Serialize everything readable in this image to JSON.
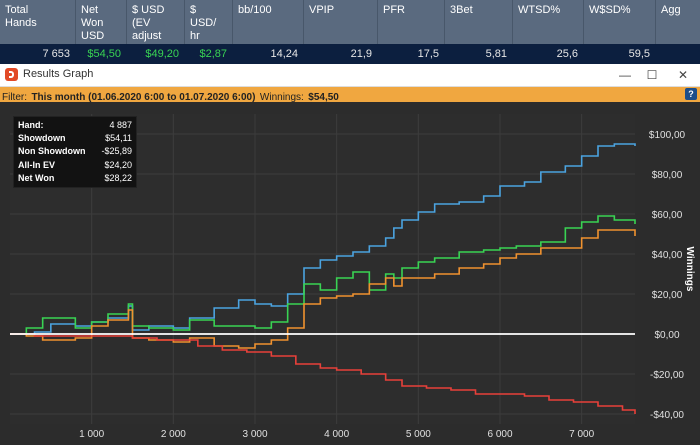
{
  "stats": {
    "headers": [
      "Total\nHands",
      "Net\nWon\nUSD",
      "$ USD\n(EV\nadjust",
      "$\nUSD/\nhr",
      "bb/100",
      "VPIP",
      "PFR",
      "3Bet",
      "WTSD%",
      "W$SD%",
      "Agg"
    ],
    "values": [
      "7 653",
      "$54,50",
      "$49,20",
      "$2,87",
      "14,24",
      "21,9",
      "17,5",
      "5,81",
      "25,6",
      "59,5",
      ""
    ]
  },
  "window": {
    "title": "Results Graph",
    "minimize": "—",
    "maximize": "☐",
    "close": "✕"
  },
  "filter": {
    "label": "Filter:",
    "range": "This month (01.06.2020 6:00 to 01.07.2020 6:00)",
    "winnings_label": "Winnings:",
    "winnings_value": "$54,50",
    "help": "?"
  },
  "legend": {
    "rows": [
      {
        "label": "Hand:",
        "value": "4 887"
      },
      {
        "label": "Showdown",
        "value": "$54,11"
      },
      {
        "label": "Non Showdown",
        "value": "-$25,89"
      },
      {
        "label": "All-In EV",
        "value": "$24,20"
      },
      {
        "label": "Net Won",
        "value": "$28,22"
      }
    ]
  },
  "chart_data": {
    "type": "line",
    "ylabel": "Winnings",
    "xlim": [
      0,
      7653
    ],
    "ylim": [
      -45,
      110
    ],
    "x_ticks": [
      "1 000",
      "2 000",
      "3 000",
      "4 000",
      "5 000",
      "6 000",
      "7 000"
    ],
    "y_ticks": [
      "$100,00",
      "$80,00",
      "$60,00",
      "$40,00",
      "$20,00",
      "$0,00",
      "-$20,00",
      "-$40,00"
    ],
    "grid": true,
    "colors": {
      "showdown": "#4ba3e0",
      "net_won": "#39d353",
      "all_in_ev": "#f0922f",
      "non_showdown": "#e8403a",
      "zero_line": "#ffffff"
    },
    "series": [
      {
        "key": "showdown",
        "x": [
          0,
          300,
          500,
          800,
          1000,
          1200,
          1450,
          1500,
          1700,
          2000,
          2200,
          2500,
          2800,
          3000,
          3200,
          3400,
          3600,
          3800,
          4000,
          4200,
          4400,
          4600,
          4700,
          4800,
          5000,
          5200,
          5500,
          5800,
          6000,
          6300,
          6500,
          6800,
          7000,
          7200,
          7400,
          7653
        ],
        "y": [
          0,
          1,
          5,
          4,
          6,
          8,
          14,
          2,
          4,
          3,
          8,
          13,
          17,
          15,
          14,
          20,
          33,
          37,
          39,
          41,
          44,
          48,
          53,
          57,
          61,
          65,
          66,
          69,
          74,
          76,
          81,
          84,
          89,
          94,
          95,
          94
        ]
      },
      {
        "key": "net_won",
        "x": [
          0,
          200,
          400,
          800,
          1000,
          1200,
          1450,
          1500,
          1700,
          2000,
          2200,
          2500,
          2800,
          3000,
          3200,
          3400,
          3600,
          3800,
          4000,
          4200,
          4400,
          4600,
          4700,
          4800,
          5000,
          5200,
          5500,
          5800,
          6000,
          6200,
          6500,
          6800,
          7000,
          7200,
          7400,
          7653
        ],
        "y": [
          0,
          3,
          8,
          3,
          6,
          10,
          15,
          4,
          3,
          2,
          7,
          4,
          4,
          3,
          6,
          15,
          25,
          22,
          28,
          31,
          22,
          30,
          28,
          33,
          36,
          38,
          41,
          42,
          43,
          44,
          46,
          53,
          56,
          59,
          57,
          55
        ]
      },
      {
        "key": "all_in_ev",
        "x": [
          0,
          200,
          400,
          800,
          1000,
          1200,
          1450,
          1500,
          1700,
          2000,
          2200,
          2500,
          2800,
          3000,
          3200,
          3400,
          3600,
          3800,
          4000,
          4200,
          4400,
          4600,
          4700,
          4800,
          5000,
          5200,
          5500,
          5800,
          6000,
          6200,
          6500,
          6800,
          7000,
          7200,
          7400,
          7653
        ],
        "y": [
          0,
          -1,
          -3,
          -2,
          4,
          7,
          12,
          -2,
          -3,
          -4,
          -2,
          -6,
          -7,
          -5,
          -3,
          3,
          15,
          18,
          19,
          20,
          25,
          28,
          24,
          28,
          28,
          30,
          33,
          35,
          38,
          40,
          43,
          43,
          48,
          52,
          52,
          49
        ]
      },
      {
        "key": "non_showdown",
        "x": [
          0,
          300,
          600,
          1000,
          1500,
          1800,
          2000,
          2300,
          2600,
          2900,
          3200,
          3500,
          3800,
          4000,
          4300,
          4600,
          4800,
          5100,
          5400,
          5700,
          6000,
          6300,
          6600,
          6900,
          7200,
          7500,
          7653
        ],
        "y": [
          0,
          -1,
          -1,
          -1,
          -2,
          -3,
          -3,
          -6,
          -8,
          -9,
          -11,
          -15,
          -17,
          -18,
          -20,
          -23,
          -26,
          -27,
          -28,
          -30,
          -30,
          -31,
          -33,
          -34,
          -36,
          -38,
          -40
        ]
      }
    ]
  }
}
